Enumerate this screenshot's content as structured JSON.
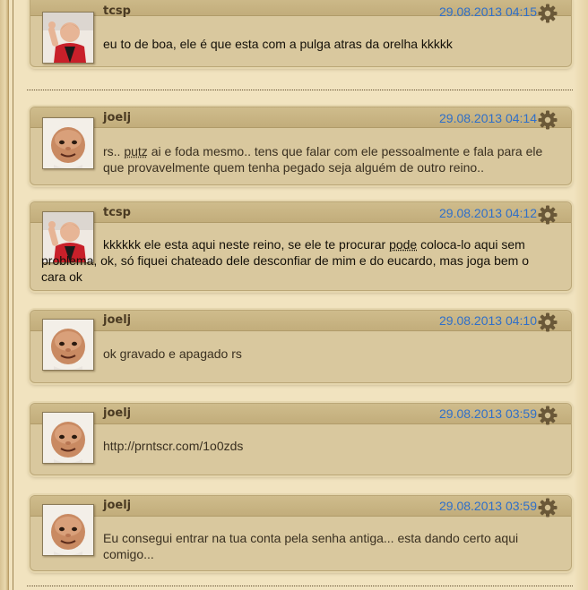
{
  "posts": [
    {
      "author": "tcsp",
      "date": "29.08.2013 04:15",
      "text": "eu to de boa, ele é que esta com a pulga atras da orelha kkkkk"
    },
    {
      "author": "joelj",
      "date": "29.08.2013 04:14",
      "text_a": "rs.. ",
      "text_u": "putz",
      "text_b": " ai e foda mesmo.. tens que falar com ele pessoalmente e fala para ele que provavelmente quem tenha pegado seja alguém de outro reino.."
    },
    {
      "author": "tcsp",
      "date": "29.08.2013 04:12",
      "text_a": "kkkkkk ele esta aqui neste reino, se ele te procurar ",
      "text_u": "pode",
      "text_b": " coloca-lo aqui sem problema, ok, só fiquei chateado dele desconfiar de mim e do eucardo, mas joga bem o cara ok"
    },
    {
      "author": "joelj",
      "date": "29.08.2013 04:10",
      "text": "ok gravado e apagado rs"
    },
    {
      "author": "joelj",
      "date": "29.08.2013 03:59",
      "text": "http://prntscr.com/1o0zds"
    },
    {
      "author": "joelj",
      "date": "29.08.2013 03:59",
      "text": "Eu consegui entrar na tua conta pela senha antiga... esta dando certo aqui comigo..."
    }
  ],
  "icons": {
    "gear": "gear-icon",
    "avatar_tcsp": "avatar-child-red-shirt",
    "avatar_joelj": "avatar-baby-face"
  },
  "colors": {
    "date": "#2f6fc9",
    "author": "#4a3a22",
    "panel": "#d9c89e",
    "page": "#f1e3bf"
  }
}
